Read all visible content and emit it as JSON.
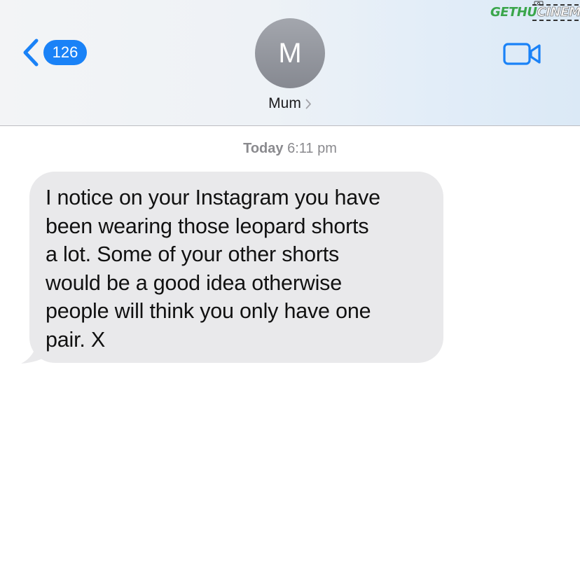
{
  "header": {
    "unread_count": "126",
    "avatar_initial": "M",
    "contact_name": "Mum"
  },
  "icons": {
    "back": "chevron-left-icon",
    "contact_more": "chevron-right-icon",
    "video": "video-camera-icon"
  },
  "watermark": {
    "part1": "GETHU",
    "part2": "CINEMA"
  },
  "thread": {
    "timestamp_day": "Today",
    "timestamp_time": " 6:11 pm",
    "messages": [
      {
        "direction": "incoming",
        "text": "I notice on your Instagram you have\nbeen wearing those leopard shorts\na lot. Some of your other shorts\nwould be a good idea otherwise\npeople will think you only have one\npair. X"
      }
    ]
  },
  "colors": {
    "accent": "#1a82f7",
    "incoming_bubble": "#e9e9eb",
    "avatar": "#8e9197",
    "timestamp": "#8a8a8e"
  }
}
